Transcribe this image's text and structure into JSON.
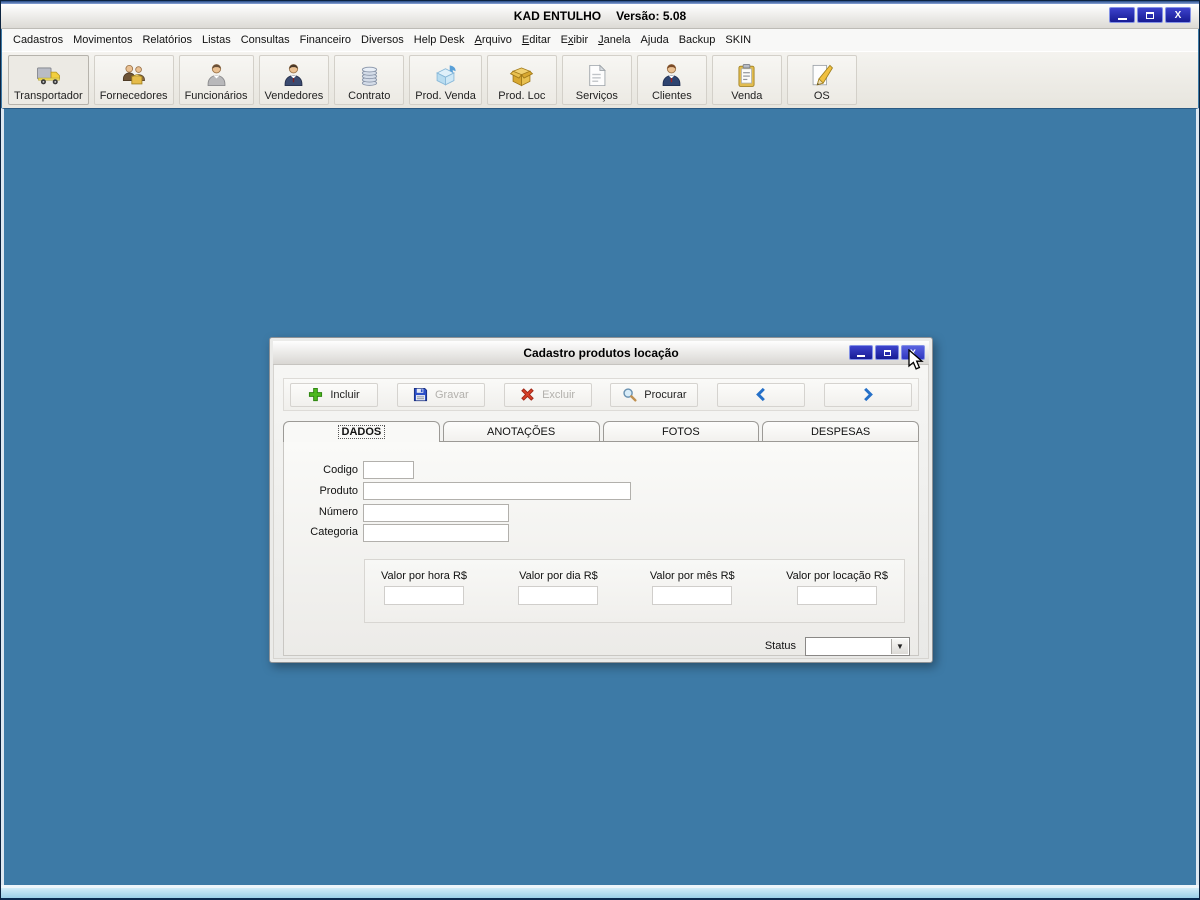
{
  "app": {
    "title": "KAD ENTULHO",
    "version": "Versão: 5.08",
    "controls": {
      "minimize": "–",
      "maximize": "□",
      "close": "X"
    }
  },
  "menu": {
    "items": [
      {
        "label": "Cadastros"
      },
      {
        "label": "Movimentos"
      },
      {
        "label": "Relatórios"
      },
      {
        "label": "Listas"
      },
      {
        "label": "Consultas"
      },
      {
        "label": "Financeiro"
      },
      {
        "label": "Diversos"
      },
      {
        "label": "Help Desk"
      },
      {
        "label": "Arquivo",
        "u": 0
      },
      {
        "label": "Editar",
        "u": 0
      },
      {
        "label": "Exibir",
        "u": 1
      },
      {
        "label": "Janela",
        "u": 0
      },
      {
        "label": "Ajuda"
      },
      {
        "label": "Backup"
      },
      {
        "label": "SKIN"
      }
    ]
  },
  "toolbar": {
    "items": [
      {
        "label": "Transportador",
        "icon": "truck-icon"
      },
      {
        "label": "Fornecedores",
        "icon": "suppliers-icon"
      },
      {
        "label": "Funcionários",
        "icon": "employee-icon"
      },
      {
        "label": "Vendedores",
        "icon": "salesperson-icon"
      },
      {
        "label": "Contrato",
        "icon": "contract-coins-icon"
      },
      {
        "label": "Prod. Venda",
        "icon": "product-sale-box-icon"
      },
      {
        "label": "Prod. Loc",
        "icon": "product-rental-box-icon"
      },
      {
        "label": "Serviços",
        "icon": "services-document-icon"
      },
      {
        "label": "Clientes",
        "icon": "clients-icon"
      },
      {
        "label": "Venda",
        "icon": "sale-clipboard-icon"
      },
      {
        "label": "OS",
        "icon": "work-order-pencil-icon"
      }
    ]
  },
  "dialog": {
    "title": "Cadastro produtos locação",
    "controls": {
      "minimize": "–",
      "maximize": "□",
      "close": "X"
    },
    "actions": [
      {
        "label": "Incluir",
        "icon": "plus-icon",
        "enabled": true
      },
      {
        "label": "Gravar",
        "icon": "save-icon",
        "enabled": false
      },
      {
        "label": "Excluir",
        "icon": "delete-icon",
        "enabled": false
      },
      {
        "label": "Procurar",
        "icon": "search-icon",
        "enabled": true
      },
      {
        "label": "",
        "icon": "chevron-left-icon",
        "enabled": true
      },
      {
        "label": "",
        "icon": "chevron-right-icon",
        "enabled": true
      }
    ],
    "tabs": [
      {
        "label": "DADOS",
        "active": true
      },
      {
        "label": "ANOTAÇÕES",
        "active": false
      },
      {
        "label": "FOTOS",
        "active": false
      },
      {
        "label": "DESPESAS",
        "active": false
      }
    ],
    "fields": {
      "codigo": {
        "label": "Codigo",
        "value": ""
      },
      "produto": {
        "label": "Produto",
        "value": ""
      },
      "numero": {
        "label": "Número",
        "value": ""
      },
      "categoria": {
        "label": "Categoria",
        "value": ""
      }
    },
    "valores": {
      "columns": [
        {
          "label": "Valor por hora R$",
          "value": ""
        },
        {
          "label": "Valor por dia R$",
          "value": ""
        },
        {
          "label": "Valor por mês R$",
          "value": ""
        },
        {
          "label": "Valor por locação R$",
          "value": ""
        }
      ]
    },
    "status": {
      "label": "Status",
      "value": ""
    }
  },
  "colors": {
    "desktop": "#3d7aa6",
    "window_button_blue": "#1c20a0",
    "accent_blue": "#2570c8",
    "disabled_text": "#b2b0ac",
    "bottom_bar": "#a8d4ea"
  }
}
